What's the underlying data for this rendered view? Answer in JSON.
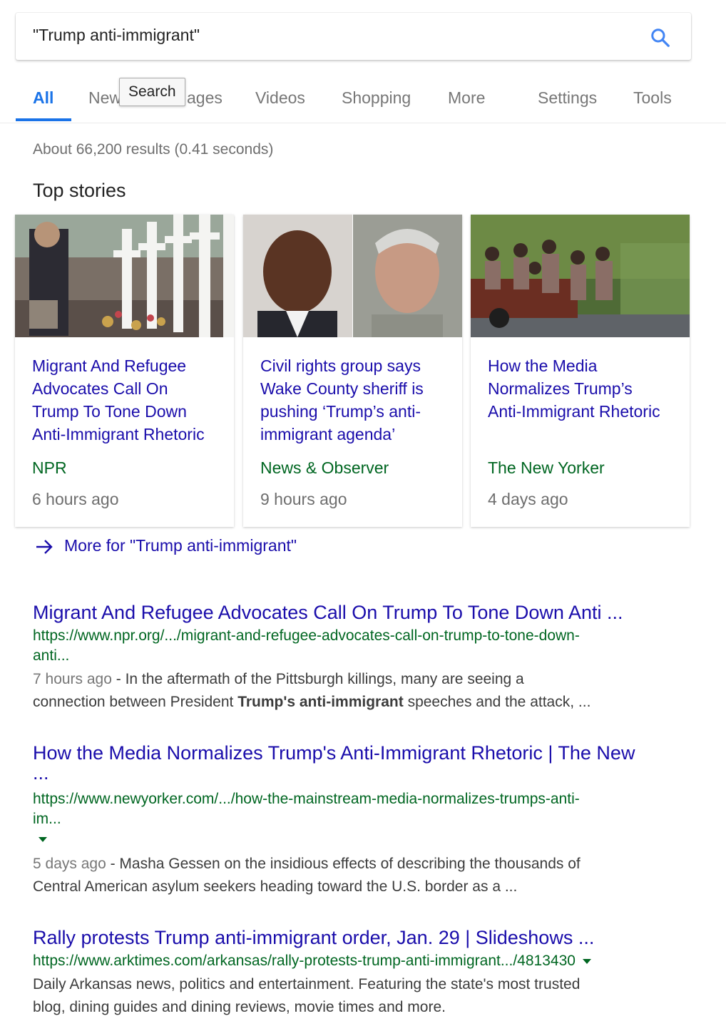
{
  "search": {
    "query": "\"Trump anti-immigrant\"",
    "icon": "search-icon"
  },
  "tabs": {
    "all": "All",
    "news_prefix": "New",
    "images_suffix": "ages",
    "videos": "Videos",
    "shopping": "Shopping",
    "more": "More",
    "settings": "Settings",
    "tools": "Tools"
  },
  "tooltip": "Search",
  "stats": "About 66,200 results (0.41 seconds)",
  "top_stories": {
    "heading": "Top stories",
    "cards": [
      {
        "title_lines": [
          "Migrant And Refugee",
          "Advocates Call On",
          "Trump To Tone Down",
          "Anti-Immigrant Rhetoric"
        ],
        "source": "NPR",
        "time": "6 hours ago"
      },
      {
        "title_lines": [
          "Civil rights group says",
          "Wake County sheriff is",
          "pushing ‘Trump’s anti-",
          "immigrant agenda’"
        ],
        "source": "News & Observer",
        "time": "9 hours ago"
      },
      {
        "title_lines": [
          "How the Media",
          "Normalizes Trump’s",
          "Anti-Immigrant Rhetoric"
        ],
        "source": "The New Yorker",
        "time": "4 days ago"
      }
    ],
    "more_link": "More for \"Trump anti-immigrant\""
  },
  "results": [
    {
      "title": "Migrant And Refugee Advocates Call On Trump To Tone Down Anti ...",
      "url_line1": "https://www.npr.org/.../migrant-and-refugee-advocates-call-on-trump-to-tone-down-",
      "url_line2": "anti...",
      "date": "7 hours ago",
      "snippet_a": " - In the aftermath of the Pittsburgh killings, many are seeing a",
      "snippet_b": "connection between President ",
      "snippet_bold": "Trump's anti-immigrant",
      "snippet_c": " speeches and the attack, ..."
    },
    {
      "title": "How the Media Normalizes Trump's Anti-Immigrant Rhetoric | The New",
      "title_line2": "...",
      "url_line1": "https://www.newyorker.com/.../how-the-mainstream-media-normalizes-trumps-anti-",
      "url_line2": "im...",
      "date": "5 days ago",
      "snippet_a": " - Masha Gessen on the insidious effects of describing the thousands of",
      "snippet_b": "Central American asylum seekers heading toward the U.S. border as a ..."
    },
    {
      "title": "Rally protests Trump anti-immigrant order, Jan. 29 | Slideshows ...",
      "url_line1": "https://www.arktimes.com/arkansas/rally-protests-trump-anti-immigrant.../4813430",
      "snippet_a": "Daily Arkansas news, politics and entertainment. Featuring the state's most trusted",
      "snippet_b": "blog, dining guides and dining reviews, movie times and more."
    }
  ],
  "colors": {
    "link": "#1a0dab",
    "url": "#006621",
    "accent": "#1a73e8",
    "muted": "#6e6e6e"
  }
}
